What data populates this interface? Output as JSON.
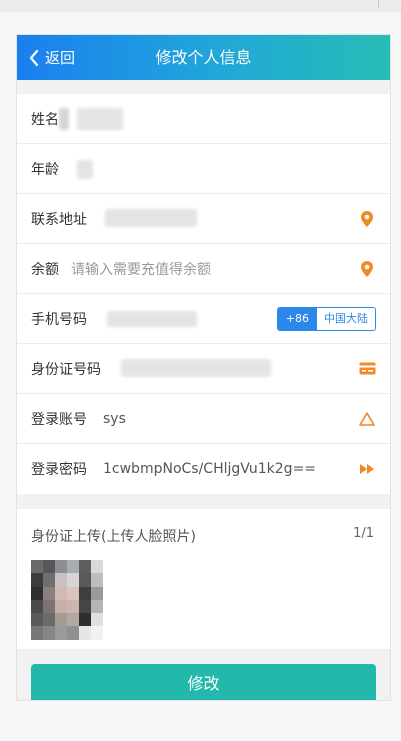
{
  "nav": {
    "back_label": "返回",
    "title": "修改个人信息"
  },
  "form": {
    "rows": [
      {
        "label": "姓名",
        "value": "",
        "blurred": true
      },
      {
        "label": "年龄",
        "value": "",
        "blurred": true
      },
      {
        "label": "联系地址",
        "value": "",
        "blurred": true,
        "icon": "location-pin-icon"
      },
      {
        "label": "余额",
        "placeholder": "请输入需要充值得余额",
        "icon": "location-pin-icon"
      },
      {
        "label": "手机号码",
        "value": "",
        "blurred": true,
        "country_code": "+86",
        "region": "中国大陆"
      },
      {
        "label": "身份证号码",
        "value": "",
        "blurred": true,
        "icon": "id-card-icon"
      },
      {
        "label": "登录账号",
        "value": "sys",
        "icon": "warning-triangle-icon"
      },
      {
        "label": "登录密码",
        "value": "1cwbmpNoCs/CHljgVu1k2g==",
        "icon": "fast-forward-icon"
      }
    ]
  },
  "upload": {
    "label": "身份证上传(上传人脸照片)",
    "count": "1/1"
  },
  "submit_label": "修改",
  "colors": {
    "nav_gradient_start": "#1a7ff0",
    "nav_gradient_end": "#27bdb4",
    "accent_orange": "#f08a24",
    "accent_blue": "#2b88e8",
    "button_teal": "#22b8ac"
  }
}
